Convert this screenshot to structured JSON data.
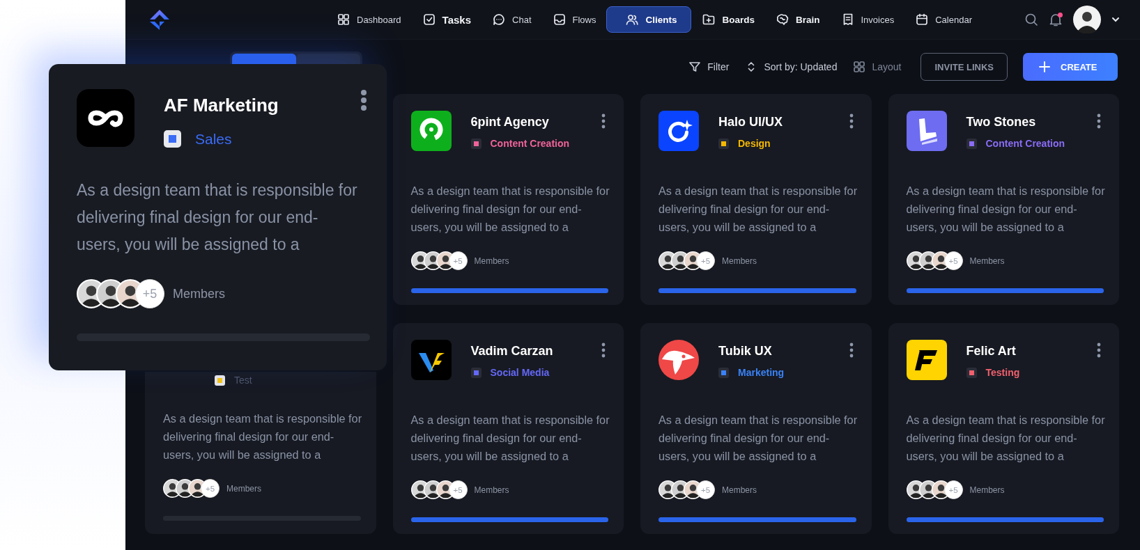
{
  "nav": {
    "items": [
      {
        "label": "Dashboard",
        "selected": false,
        "bold": false
      },
      {
        "label": "Tasks",
        "selected": false,
        "bold": true
      },
      {
        "label": "Chat",
        "selected": false,
        "bold": false
      },
      {
        "label": "Flows",
        "selected": false,
        "bold": false
      },
      {
        "label": "Clients",
        "selected": true,
        "bold": true
      },
      {
        "label": "Boards",
        "selected": false,
        "bold": true
      },
      {
        "label": "Brain",
        "selected": false,
        "bold": true
      },
      {
        "label": "Invoices",
        "selected": false,
        "bold": false
      },
      {
        "label": "Calendar",
        "selected": false,
        "bold": false
      }
    ],
    "notifications": {
      "unread": true
    }
  },
  "view_tabs": [
    {
      "selected": true
    },
    {
      "selected": false
    }
  ],
  "toolbar": {
    "filter": "Filter",
    "sort": "Sort by: Updated",
    "layout": "Layout",
    "invite_button": "INVITE LINKS",
    "create_button": "CREATE"
  },
  "cards": [
    {
      "kind": "full",
      "name": "6pint Agency",
      "tag": {
        "label": "Content Creation",
        "color": "#f0639a"
      },
      "description": "As a design team that is responsible for delivering final design for our end-users, you will be assigned to a",
      "members": "Members",
      "extra": "+5",
      "level": 1
    },
    {
      "kind": "full",
      "name": "Halo UI/UX",
      "tag": {
        "label": "Design",
        "color": "#f5b800"
      },
      "description": "As a design team that is responsible for delivering final design for our end-users, you will be assigned to a",
      "members": "Members",
      "extra": "+5",
      "level": 1
    },
    {
      "kind": "full",
      "name": "Two Stones",
      "tag": {
        "label": "Content Creation",
        "color": "#8a6cf6"
      },
      "description": "As a design team that is responsible for delivering final design for our end-users, you will be assigned to a",
      "members": "Members",
      "extra": "+5",
      "level": 1
    },
    {
      "kind": "partial",
      "tag": {
        "label": "Test",
        "color": "#f5c518"
      },
      "description": "As a design team that is responsible for delivering final design for our end-users, you will be assigned to a",
      "members": "Members",
      "extra": "+5",
      "level": 0
    },
    {
      "kind": "full",
      "name": "Vadim Carzan",
      "tag": {
        "label": "Social Media",
        "color": "#6468f6"
      },
      "description": "As a design team that is responsible for delivering final design for our end-users, you will be assigned to a",
      "members": "Members",
      "extra": "+5",
      "level": 1
    },
    {
      "kind": "full",
      "name": "Tubik UX",
      "tag": {
        "label": "Marketing",
        "color": "#3a82f6"
      },
      "description": "As a design team that is responsible for delivering final design for our end-users, you will be assigned to a",
      "members": "Members",
      "extra": "+5",
      "level": 1
    },
    {
      "kind": "full",
      "name": "Felic Art",
      "tag": {
        "label": "Testing",
        "color": "#f0606e"
      },
      "description": "As a design team that is responsible for delivering final design for our end-users, you will be assigned to a",
      "members": "Members",
      "extra": "+5",
      "level": 1
    }
  ],
  "dragged_card": {
    "kind": "full",
    "name": "AF Marketing",
    "tag": {
      "label": "Sales",
      "color": "#3b6cf6"
    },
    "description": "As a design team that is responsible for delivering final design for our end-users, you will be assigned to a",
    "members": "Members",
    "extra": "+5",
    "level": 0
  }
}
